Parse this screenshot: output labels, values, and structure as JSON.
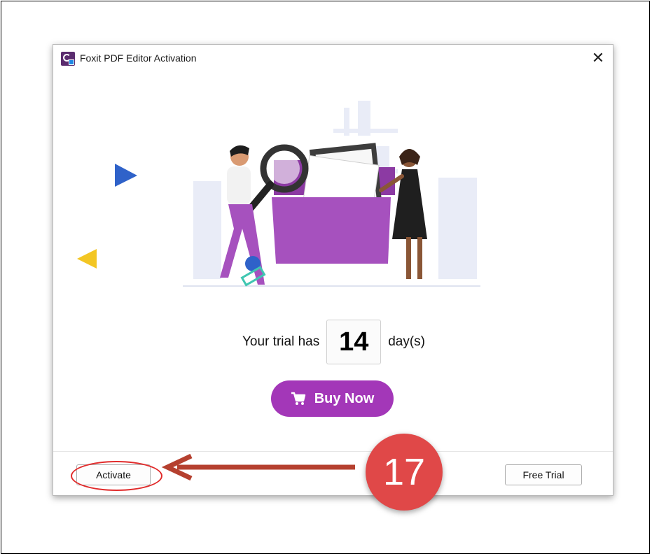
{
  "dialog": {
    "title": "Foxit PDF Editor Activation",
    "close_icon": "close-icon",
    "app_icon": "foxit-logo-icon"
  },
  "trial": {
    "prefix": "Your trial has",
    "days": "14",
    "suffix": "day(s)"
  },
  "buy": {
    "label": "Buy Now",
    "icon": "cart-icon",
    "color": "#a337b8"
  },
  "footer": {
    "activate_label": "Activate",
    "free_trial_label": "Free Trial"
  },
  "annotation": {
    "step_number": "17",
    "badge_color": "#e04848",
    "arrow_color": "#b5402f",
    "highlight_color": "#e12b2b"
  },
  "illustration": {
    "decor_colors": {
      "blue": "#2f62c9",
      "yellow": "#f3c623",
      "purple": "#a651be",
      "teal": "#3fc6b1"
    }
  }
}
